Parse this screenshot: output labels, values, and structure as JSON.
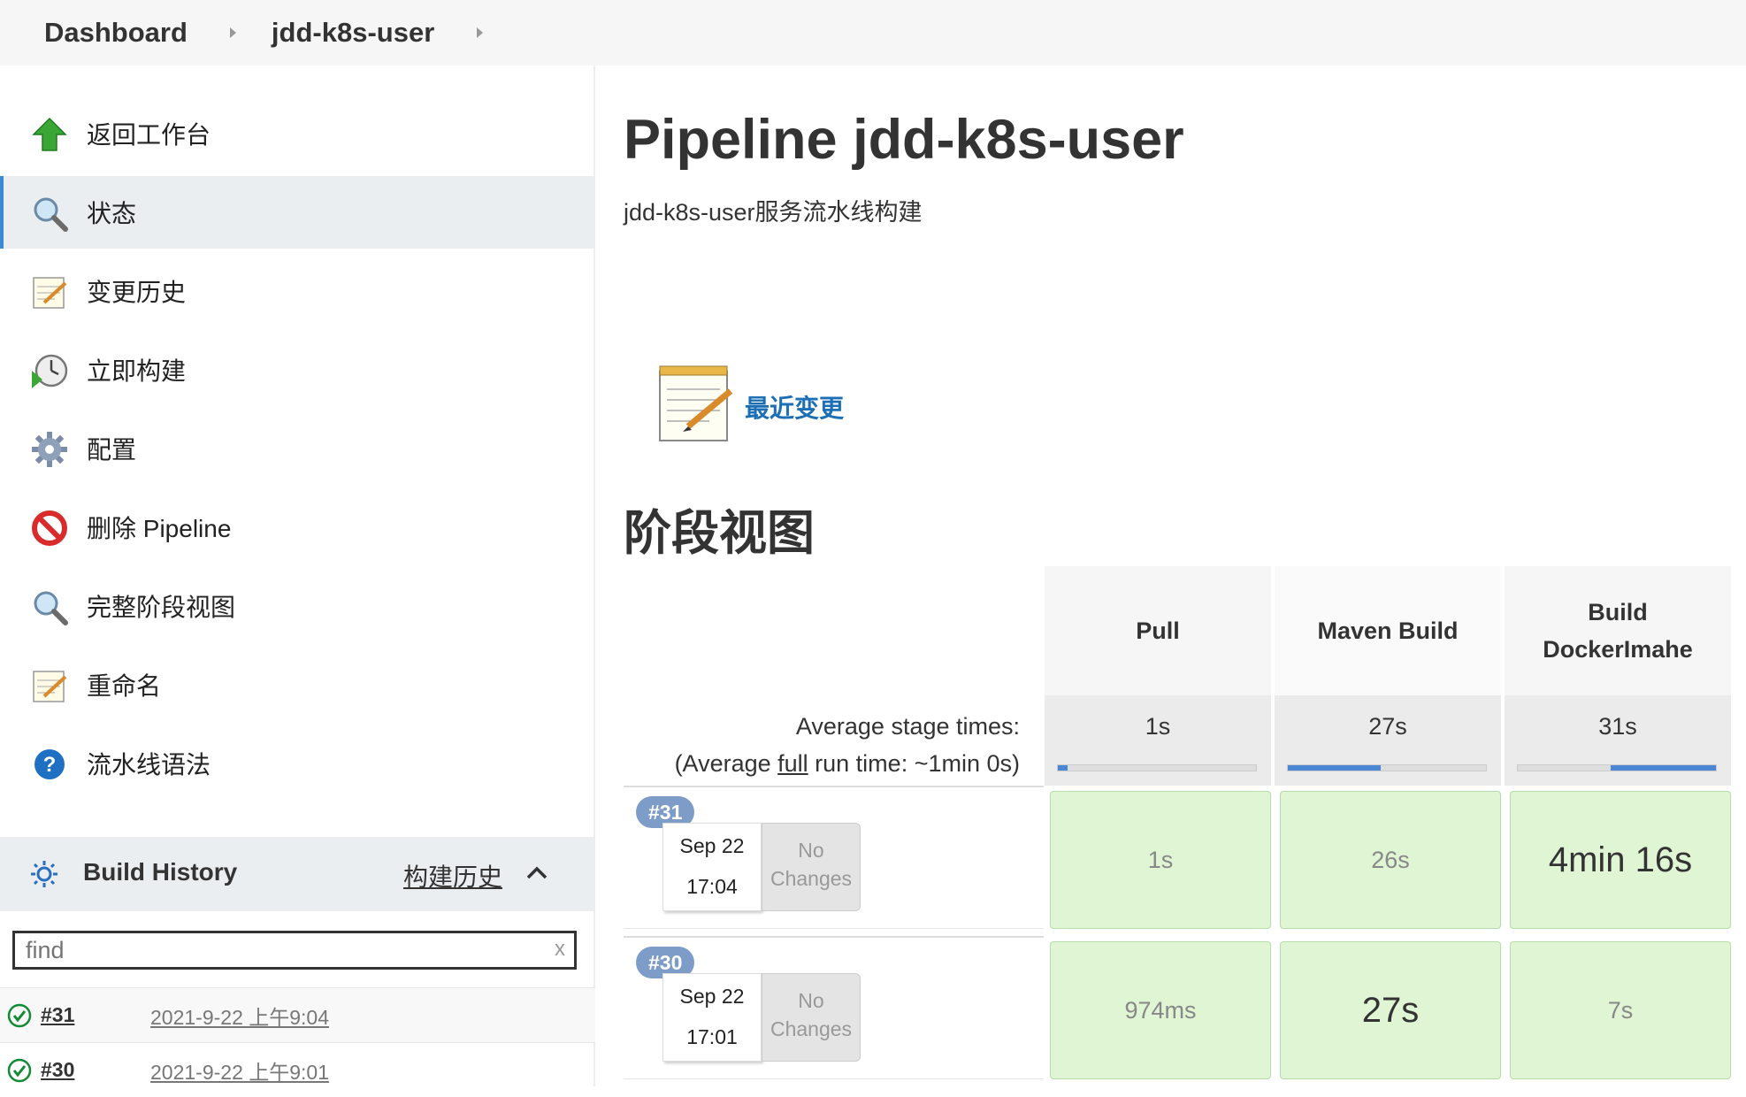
{
  "breadcrumb": {
    "items": [
      "Dashboard",
      "jdd-k8s-user"
    ]
  },
  "sidebar": {
    "tasks": [
      {
        "label": "返回工作台",
        "icon": "up-arrow-icon"
      },
      {
        "label": "状态",
        "icon": "magnifier-icon",
        "active": true
      },
      {
        "label": "变更历史",
        "icon": "notepad-icon"
      },
      {
        "label": "立即构建",
        "icon": "build-clock-icon"
      },
      {
        "label": "配置",
        "icon": "gear-icon"
      },
      {
        "label": "删除 Pipeline",
        "icon": "no-entry-icon"
      },
      {
        "label": "完整阶段视图",
        "icon": "magnifier-icon"
      },
      {
        "label": "重命名",
        "icon": "notepad-icon"
      },
      {
        "label": "流水线语法",
        "icon": "help-icon"
      }
    ],
    "build_history": {
      "title": "Build History",
      "link": "构建历史",
      "search_placeholder": "find",
      "clear": "x",
      "builds": [
        {
          "number": "#31",
          "date": "2021-9-22 上午9:04"
        },
        {
          "number": "#30",
          "date": "2021-9-22 上午9:01"
        }
      ]
    }
  },
  "main": {
    "title": "Pipeline jdd-k8s-user",
    "description": "jdd-k8s-user服务流水线构建",
    "recent_changes": "最近变更",
    "stage_view_title": "阶段视图",
    "stage_view": {
      "avg_label_line1": "Average stage times:",
      "avg_label_line2_prefix": "(Average ",
      "avg_label_line2_link": "full",
      "avg_label_line2_suffix": " run time: ~1min 0s)",
      "stages": [
        {
          "name": "Pull",
          "avg": "1s",
          "bar_fraction": 0.05
        },
        {
          "name": "Maven Build",
          "avg": "27s",
          "bar_fraction": 0.47
        },
        {
          "name": "Build DockerImahe",
          "name_line1": "Build",
          "name_line2": "DockerImahe",
          "avg": "31s",
          "bar_fraction": 0.53
        }
      ],
      "runs": [
        {
          "badge": "#31",
          "date": "Sep 22",
          "time": "17:04",
          "changes_line1": "No",
          "changes_line2": "Changes",
          "durations": [
            "1s",
            "26s",
            "4min 16s"
          ]
        },
        {
          "badge": "#30",
          "date": "Sep 22",
          "time": "17:01",
          "changes_line1": "No",
          "changes_line2": "Changes",
          "durations": [
            "974ms",
            "27s",
            "7s"
          ]
        }
      ]
    }
  }
}
